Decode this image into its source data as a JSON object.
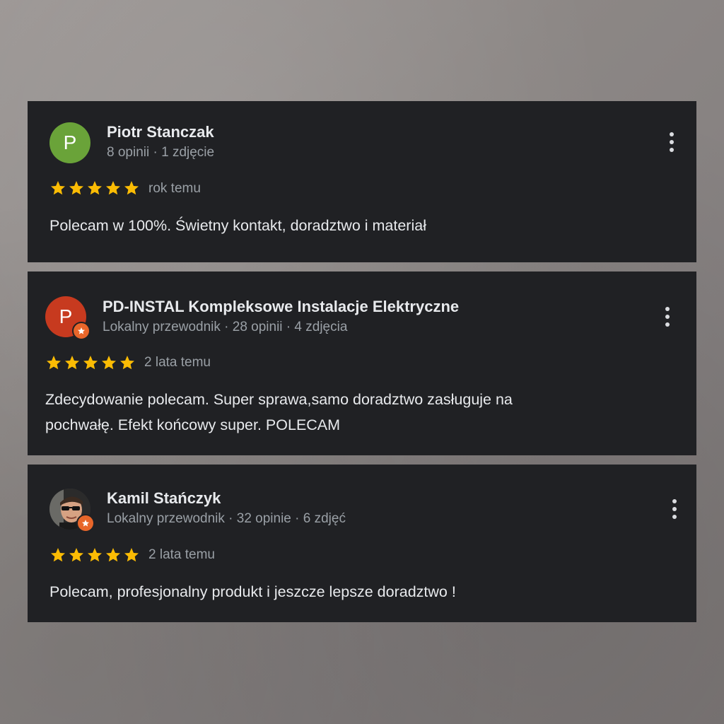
{
  "reviews": [
    {
      "avatar_letter": "P",
      "avatar_color": "#6aa339",
      "avatar_type": "letter",
      "local_guide_badge": false,
      "name": "Piotr Stanczak",
      "meta": "8 opinii · 1 zdjęcie",
      "rating": 5,
      "date": "rok temu",
      "text": "Polecam w 100%. Świetny kontakt, doradztwo i materiał"
    },
    {
      "avatar_letter": "P",
      "avatar_color": "#c73a1f",
      "avatar_type": "letter",
      "local_guide_badge": true,
      "name": "PD-INSTAL Kompleksowe Instalacje Elektryczne",
      "meta": "Lokalny przewodnik · 28 opinii · 4 zdjęcia",
      "rating": 5,
      "date": "2 lata temu",
      "text_line1": "Zdecydowanie polecam. Super sprawa,samo doradztwo zasługuje na",
      "text_line2": "pochwałę. Efekt końcowy super. POLECAM"
    },
    {
      "avatar_type": "photo",
      "local_guide_badge": true,
      "name": "Kamil Stańczyk",
      "meta": "Lokalny przewodnik · 32 opinie · 6 zdjęć",
      "rating": 5,
      "date": "2 lata temu",
      "text": "Polecam, profesjonalny produkt i jeszcze lepsze doradztwo !"
    }
  ],
  "colors": {
    "card_bg": "#202124",
    "star": "#fbbc04",
    "local_guide_badge": "#e8662a",
    "name_text": "#e8eaed",
    "meta_text": "#9aa0a6"
  },
  "icons": {
    "star": "star-icon",
    "menu": "more-vert-icon",
    "badge": "local-guide-star-icon"
  }
}
